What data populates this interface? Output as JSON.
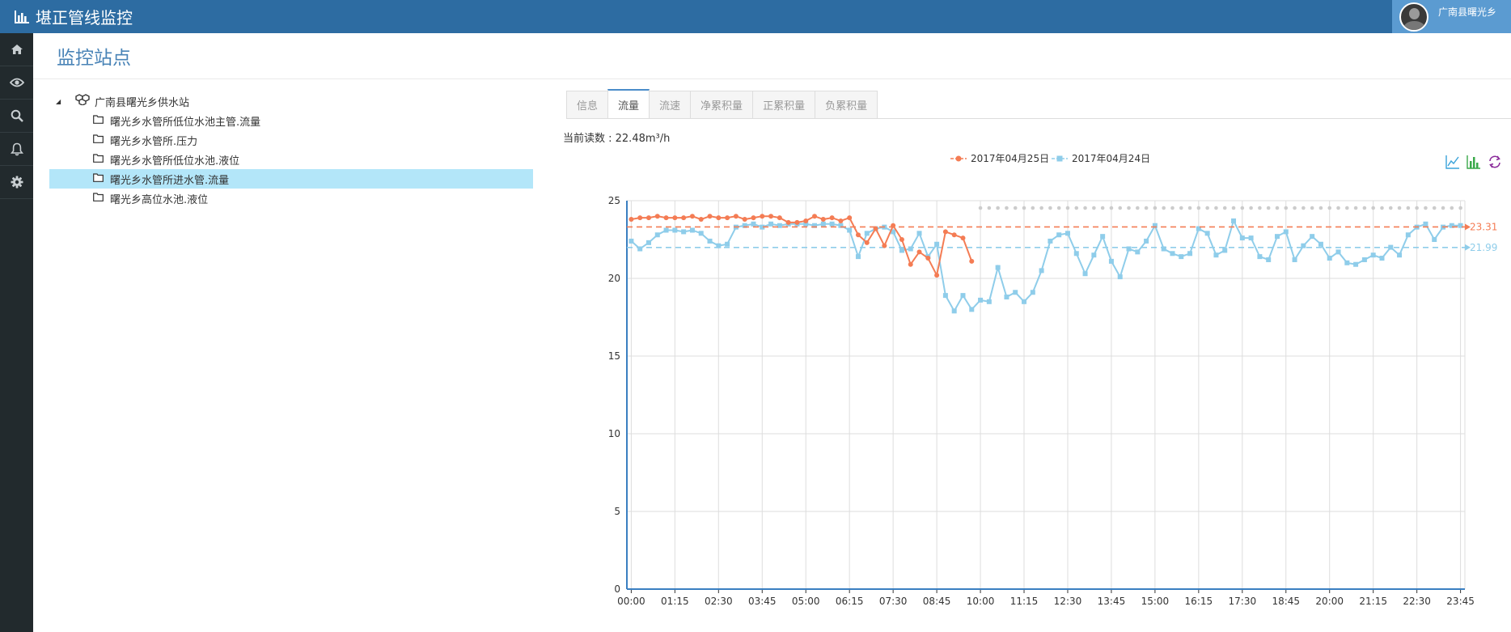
{
  "app": {
    "title": "堪正管线监控",
    "user_name": "广南县曙光乡"
  },
  "sidebar": {
    "items": [
      {
        "icon": "home-icon"
      },
      {
        "icon": "eye-icon"
      },
      {
        "icon": "search-icon"
      },
      {
        "icon": "bell-icon"
      },
      {
        "icon": "gear-icon"
      }
    ]
  },
  "page": {
    "title": "监控站点"
  },
  "tree": {
    "root": "广南县曙光乡供水站",
    "items": [
      {
        "label": "曙光乡水管所低位水池主管.流量",
        "selected": false
      },
      {
        "label": "曙光乡水管所.压力",
        "selected": false
      },
      {
        "label": "曙光乡水管所低位水池.液位",
        "selected": false
      },
      {
        "label": "曙光乡水管所进水管.流量",
        "selected": true
      },
      {
        "label": "曙光乡高位水池.液位",
        "selected": false
      }
    ]
  },
  "tabs": [
    {
      "label": "信息",
      "active": false
    },
    {
      "label": "流量",
      "active": true
    },
    {
      "label": "流速",
      "active": false
    },
    {
      "label": "净累积量",
      "active": false
    },
    {
      "label": "正累积量",
      "active": false
    },
    {
      "label": "负累积量",
      "active": false
    }
  ],
  "reading": {
    "text": "当前读数 : 22.48m³/h"
  },
  "toolbox": [
    {
      "icon": "line-chart-icon"
    },
    {
      "icon": "bar-chart-icon"
    },
    {
      "icon": "refresh-icon"
    }
  ],
  "chart_data": {
    "type": "line",
    "x_step_minutes": 15,
    "xticks": [
      "00:00",
      "01:15",
      "02:30",
      "03:45",
      "05:00",
      "06:15",
      "07:30",
      "08:45",
      "10:00",
      "11:15",
      "12:30",
      "13:45",
      "15:00",
      "16:15",
      "17:30",
      "18:45",
      "20:00",
      "21:15",
      "22:30",
      "23:45"
    ],
    "ylim": [
      0,
      25
    ],
    "yticks": [
      0,
      5,
      10,
      15,
      20,
      25
    ],
    "grid": true,
    "legend_position": "top-center",
    "series": [
      {
        "name": "2017年04月25日",
        "color": "#f47c54",
        "marker": "circle",
        "avg_line": 23.31,
        "avg_label": "23.31",
        "values": [
          23.8,
          23.9,
          23.9,
          24.0,
          23.9,
          23.9,
          23.9,
          24.0,
          23.8,
          24.0,
          23.9,
          23.9,
          24.0,
          23.8,
          23.9,
          24.0,
          24.0,
          23.9,
          23.6,
          23.6,
          23.7,
          24.0,
          23.8,
          23.9,
          23.7,
          23.9,
          22.8,
          22.3,
          23.2,
          22.1,
          23.4,
          22.5,
          20.9,
          21.7,
          21.3,
          20.2,
          23.0,
          22.8,
          22.6,
          21.1
        ]
      },
      {
        "name": "2017年04月24日",
        "color": "#8fcdea",
        "marker": "square",
        "avg_line": 21.99,
        "avg_label": "21.99",
        "values": [
          22.4,
          21.9,
          22.3,
          22.8,
          23.1,
          23.1,
          23.0,
          23.1,
          22.9,
          22.4,
          22.1,
          22.2,
          23.3,
          23.4,
          23.5,
          23.3,
          23.5,
          23.4,
          23.5,
          23.5,
          23.5,
          23.4,
          23.5,
          23.5,
          23.4,
          23.1,
          21.4,
          22.9,
          23.2,
          23.3,
          23.0,
          21.8,
          21.9,
          22.9,
          21.4,
          22.2,
          18.9,
          17.9,
          18.9,
          18.0,
          18.6,
          18.5,
          20.7,
          18.8,
          19.1,
          18.5,
          19.1,
          20.5,
          22.4,
          22.8,
          22.9,
          21.6,
          20.3,
          21.5,
          22.7,
          21.1,
          20.1,
          21.9,
          21.7,
          22.4,
          23.4,
          21.9,
          21.6,
          21.4,
          21.6,
          23.2,
          22.9,
          21.5,
          21.8,
          23.7,
          22.6,
          22.6,
          21.4,
          21.2,
          22.7,
          23.0,
          21.2,
          22.1,
          22.7,
          22.2,
          21.3,
          21.7,
          21.0,
          20.9,
          21.2,
          21.5,
          21.3,
          22.0,
          21.5,
          22.8,
          23.3,
          23.5,
          22.5,
          23.3,
          23.4,
          23.4
        ]
      }
    ]
  }
}
